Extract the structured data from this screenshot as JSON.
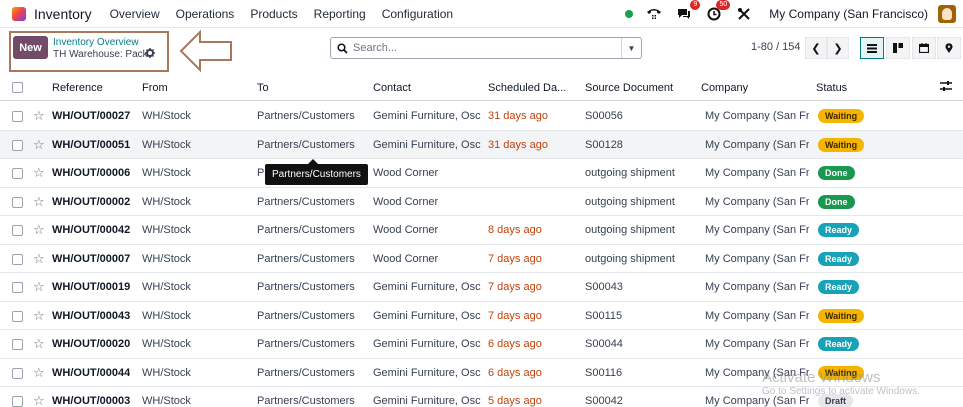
{
  "navbar": {
    "app_name": "Inventory",
    "menu": [
      "Overview",
      "Operations",
      "Products",
      "Reporting",
      "Configuration"
    ],
    "messages_count": "9",
    "activities_count": "50",
    "company": "My Company (San Francisco)"
  },
  "control": {
    "new_label": "New",
    "breadcrumb_parent": "Inventory Overview",
    "breadcrumb_current": "TH Warehouse: Pack",
    "search_placeholder": "Search...",
    "pager": "1-80 / 154"
  },
  "table": {
    "headers": {
      "reference": "Reference",
      "from": "From",
      "to": "To",
      "contact": "Contact",
      "scheduled": "Scheduled Da...",
      "source": "Source Document",
      "company": "Company",
      "status": "Status"
    },
    "rows": [
      {
        "ref": "WH/OUT/00027",
        "from": "WH/Stock",
        "to": "Partners/Customers",
        "contact": "Gemini Furniture, Osca...",
        "scheduled": "31 days ago",
        "source": "S00056",
        "company": "My Company (San Fra...",
        "status": "Waiting"
      },
      {
        "ref": "WH/OUT/00051",
        "from": "WH/Stock",
        "to": "Partners/Customers",
        "contact": "Gemini Furniture, Osca...",
        "scheduled": "31 days ago",
        "source": "S00128",
        "company": "My Company (San Fra...",
        "status": "Waiting"
      },
      {
        "ref": "WH/OUT/00006",
        "from": "WH/Stock",
        "to": "Pa",
        "contact": "Wood Corner",
        "scheduled": "",
        "source": "outgoing shipment",
        "company": "My Company (San Fra...",
        "status": "Done"
      },
      {
        "ref": "WH/OUT/00002",
        "from": "WH/Stock",
        "to": "Partners/Customers",
        "contact": "Wood Corner",
        "scheduled": "",
        "source": "outgoing shipment",
        "company": "My Company (San Fra...",
        "status": "Done"
      },
      {
        "ref": "WH/OUT/00042",
        "from": "WH/Stock",
        "to": "Partners/Customers",
        "contact": "Wood Corner",
        "scheduled": "8 days ago",
        "source": "outgoing shipment",
        "company": "My Company (San Fra...",
        "status": "Ready"
      },
      {
        "ref": "WH/OUT/00007",
        "from": "WH/Stock",
        "to": "Partners/Customers",
        "contact": "Wood Corner",
        "scheduled": "7 days ago",
        "source": "outgoing shipment",
        "company": "My Company (San Fra...",
        "status": "Ready"
      },
      {
        "ref": "WH/OUT/00019",
        "from": "WH/Stock",
        "to": "Partners/Customers",
        "contact": "Gemini Furniture, Osca...",
        "scheduled": "7 days ago",
        "source": "S00043",
        "company": "My Company (San Fra...",
        "status": "Ready"
      },
      {
        "ref": "WH/OUT/00043",
        "from": "WH/Stock",
        "to": "Partners/Customers",
        "contact": "Gemini Furniture, Osca...",
        "scheduled": "7 days ago",
        "source": "S00115",
        "company": "My Company (San Fra...",
        "status": "Waiting"
      },
      {
        "ref": "WH/OUT/00020",
        "from": "WH/Stock",
        "to": "Partners/Customers",
        "contact": "Gemini Furniture, Osca...",
        "scheduled": "6 days ago",
        "source": "S00044",
        "company": "My Company (San Fra...",
        "status": "Ready"
      },
      {
        "ref": "WH/OUT/00044",
        "from": "WH/Stock",
        "to": "Partners/Customers",
        "contact": "Gemini Furniture, Osca...",
        "scheduled": "6 days ago",
        "source": "S00116",
        "company": "My Company (San Fra...",
        "status": "Waiting"
      },
      {
        "ref": "WH/OUT/00003",
        "from": "WH/Stock",
        "to": "Partners/Customers",
        "contact": "Gemini Furniture, Osca...",
        "scheduled": "5 days ago",
        "source": "S00042",
        "company": "My Company (San Fra...",
        "status": "Draft"
      }
    ]
  },
  "tooltip": "Partners/Customers",
  "watermark": {
    "title": "Activate Windows",
    "subtitle": "Go to Settings to activate Windows."
  },
  "colors": {
    "brand": "#714b67",
    "accent": "#017e84",
    "overdue": "#c2410c",
    "annotation": "#a8785a"
  }
}
